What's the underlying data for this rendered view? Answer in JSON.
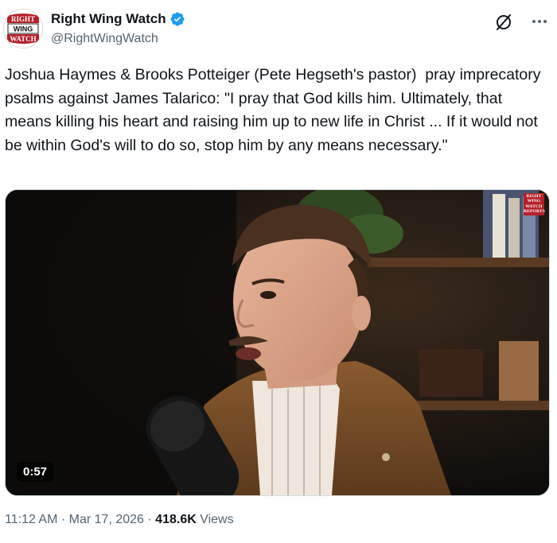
{
  "author": {
    "display_name": "Right Wing Watch",
    "handle": "@RightWingWatch",
    "verified": true,
    "avatar_text": [
      "RIGHT",
      "WING",
      "WATCH"
    ]
  },
  "actions": {
    "grok_icon": "grok-icon",
    "more_icon": "more-icon"
  },
  "tweet": {
    "text": "Joshua Haymes & Brooks Potteiger (Pete Hegseth's pastor)  pray imprecatory psalms against James Talarico: \"I pray that God kills him. Ultimately, that means killing his heart and raising him up to new life in Christ ... If it would not be within God's will to do so, stop him by any means necessary.\""
  },
  "media": {
    "duration": "0:57",
    "watermark": [
      "RIGHT",
      "WING",
      "WATCH",
      "REPORTS"
    ]
  },
  "meta": {
    "time": "11:12 AM",
    "separator": "·",
    "date": "Mar 17, 2026",
    "views_count": "418.6K",
    "views_label": "Views"
  },
  "colors": {
    "text": "#0f1419",
    "secondary": "#536471",
    "verified_blue": "#1d9bf0",
    "brand_red": "#b5202a"
  }
}
